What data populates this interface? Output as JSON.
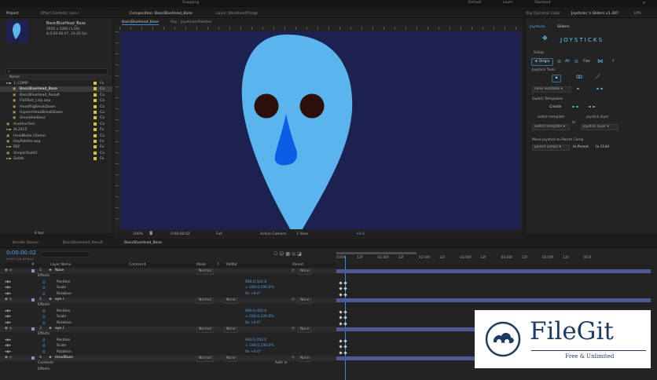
{
  "topbar": {
    "title": "Snapping",
    "workspaces": [
      "Default",
      "Learn",
      "Standard"
    ]
  },
  "project_panel": {
    "tabs": [
      "Project",
      "Effect Controls: eye.r"
    ],
    "thumb_title": "BasicBlueHead_Base",
    "thumb_info1": "1920 x 1080 (1.00)",
    "thumb_info2": "Δ 0:00:06:07, 24.00 fps",
    "search_placeholder": "ρ·",
    "col_name": "Name",
    "items": [
      {
        "name": "1_COMP",
        "color": "#d8c23a",
        "indent": 0,
        "folder": true
      },
      {
        "name": "BasicBlueHead_Base",
        "color": "#d8c23a",
        "indent": 1,
        "selected": true
      },
      {
        "name": "BasicBlueHead_Result",
        "color": "#d8c23a",
        "indent": 1
      },
      {
        "name": "FlatText_Lisp.aep",
        "color": "#d8c23a",
        "indent": 1
      },
      {
        "name": "HeadRigBreakDown",
        "color": "#d8c23a",
        "indent": 1
      },
      {
        "name": "HipsterHeadBreakDown",
        "color": "#d8c23a",
        "indent": 1
      },
      {
        "name": "SmoothieBase",
        "color": "#d8c23a",
        "indent": 1
      },
      {
        "name": "AnotherTest",
        "color": "#d8c23a",
        "indent": 0
      },
      {
        "name": "AL2015",
        "color": "#d8c23a",
        "indent": 0,
        "folder": true
      },
      {
        "name": "HeadBobs+Demo",
        "color": "#d8c23a",
        "indent": 0
      },
      {
        "name": "RayPalette.aep",
        "color": "#d8c23a",
        "indent": 0
      },
      {
        "name": "REF",
        "color": "#d8c23a",
        "indent": 0,
        "folder": true
      },
      {
        "name": "SimpleTest01",
        "color": "#d8c23a",
        "indent": 0
      },
      {
        "name": "Solids",
        "color": "#d8c23a",
        "indent": 0,
        "folder": true
      }
    ],
    "type_col": [
      "Fo",
      "Co",
      "Co",
      "Co",
      "Co",
      "Co",
      "Co",
      "Co",
      "Fo",
      "Co",
      "Fo",
      "Fo",
      "Co",
      "Fo"
    ],
    "bottom": "8 bpc"
  },
  "comp_panel": {
    "tabs": [
      "Composition: BasicBlueHead_Base",
      "Layer: BlueHeadThings"
    ],
    "subtabs": [
      "BasicBlueHead_Base",
      "Ray - JoystickerPalettes"
    ],
    "footer": {
      "zoom": "100%",
      "time": "0:00:00:02",
      "res": "Full",
      "camera": "Active Camera",
      "views": "1 View",
      "exposure": "+0.0"
    },
    "bg_color": "#1d2150",
    "head_color": "#5ab4ee",
    "eye_color": "#2c1009",
    "nose_color": "#0a5ee6"
  },
  "joysticks_panel": {
    "tabs": [
      "Ray Dynamic Color",
      "Joysticks 'n Sliders v1.307",
      "Effe"
    ],
    "subtabs": [
      "Joysticks",
      "Sliders"
    ],
    "logo": "JOYSTICKS",
    "setup_label": "Setup",
    "origin": "Origin",
    "all": "All",
    "flat": "Flat",
    "joystick_tools": "Joystick Tools",
    "none_available": "none available",
    "switch_templates": "Switch Templates",
    "create": "Create",
    "switch_template": "switch template",
    "joystick_layer": "joystick layer",
    "switch_templ_sel": "switch template",
    "to": "to",
    "joystick_layer_sel": "joystick layer",
    "move_joystick": "Move Joystick to Parent Comp",
    "parent_comps": "parent comps",
    "to_parent": "to Parent",
    "to_child": "to Child"
  },
  "timeline": {
    "tabs": [
      "Render Queue",
      "BasicBlueHead_Result",
      "BasicBlueHead_Base"
    ],
    "timecode": "0:00:00:02",
    "frame_sub": "00002 (24.00 fps)",
    "columns": [
      "#",
      "Layer Name",
      "Comment",
      "Mode",
      "T",
      "TrkMat",
      "Parent"
    ],
    "rows": [
      {
        "type": "layer",
        "num": "1",
        "name": "Nose",
        "mode": "Normal",
        "trk": "",
        "parent": "None"
      },
      {
        "type": "group",
        "name": "Effects"
      },
      {
        "type": "prop",
        "name": "Position",
        "val": "960.0,524.0"
      },
      {
        "type": "prop",
        "name": "Scale",
        "val": "∞ 100.0,100.0%"
      },
      {
        "type": "prop",
        "name": "Rotation",
        "val": "0x +0.0°"
      },
      {
        "type": "layer",
        "num": "2",
        "name": "eye.r",
        "mode": "Normal",
        "trk": "None",
        "parent": "None"
      },
      {
        "type": "group",
        "name": "Effects"
      },
      {
        "type": "prop",
        "name": "Position",
        "val": "960.0,450.0"
      },
      {
        "type": "prop",
        "name": "Scale",
        "val": "∞ 100.0,100.0%"
      },
      {
        "type": "prop",
        "name": "Rotation",
        "val": "0x +0.0°"
      },
      {
        "type": "layer",
        "num": "3",
        "name": "eye.l",
        "mode": "Normal",
        "trk": "None",
        "parent": "None"
      },
      {
        "type": "group",
        "name": "Effects"
      },
      {
        "type": "prop",
        "name": "Position",
        "val": "960.0,450.0"
      },
      {
        "type": "prop",
        "name": "Scale",
        "val": "∞ 100.0,100.0%"
      },
      {
        "type": "prop",
        "name": "Rotation",
        "val": "0x +0.0°"
      },
      {
        "type": "layer",
        "num": "4",
        "name": "HeadBase",
        "mode": "Normal",
        "trk": "None",
        "parent": "None"
      },
      {
        "type": "group",
        "name": "Contents",
        "extra": "Add: ⊙"
      },
      {
        "type": "group",
        "name": "Effects"
      }
    ],
    "ruler": [
      "0:00f",
      "12f",
      "01:00f",
      "12f",
      "02:00f",
      "12f",
      "03:00f",
      "12f",
      "04:00f",
      "12f",
      "05:00f",
      "12f",
      "06:0"
    ]
  },
  "watermark": {
    "title": "FileGit",
    "subtitle": "Free & Unlimited"
  }
}
